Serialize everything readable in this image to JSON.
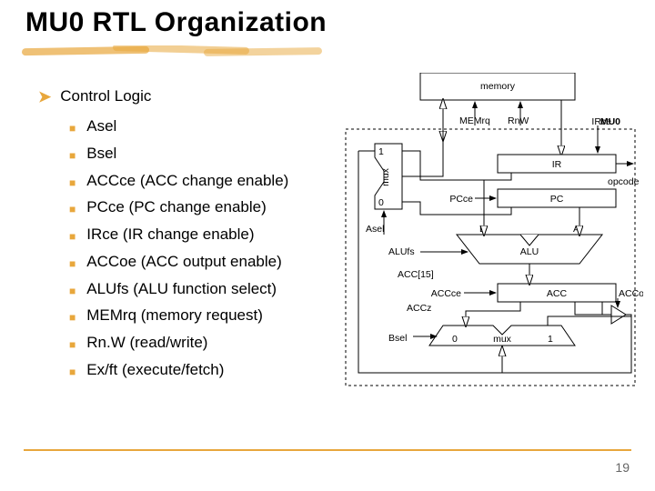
{
  "title": "MU0 RTL Organization",
  "heading": "Control Logic",
  "items": [
    "Asel",
    "Bsel",
    "ACCce (ACC change enable)",
    "PCce (PC change enable)",
    "IRce (IR change enable)",
    "ACCoe (ACC output enable)",
    "ALUfs (ALU function select)",
    "MEMrq (memory request)",
    "Rn.W (read/write)",
    "Ex/ft (execute/fetch)"
  ],
  "diagram": {
    "mu0": "MU0",
    "memory": "memory",
    "memrq": "MEMrq",
    "rnw": "RnW",
    "irce": "IRce",
    "ir": "IR",
    "opcode": "opcode",
    "pc": "PC",
    "pcce": "PCce",
    "asel": "Asel",
    "mux_top": "mux",
    "mux_1": "1",
    "mux_0": "0",
    "alufs": "ALUfs",
    "alu": "ALU",
    "b": "B",
    "a": "A",
    "accce": "ACCce",
    "acc": "ACC",
    "acc15": "ACC[15]",
    "accz": "ACCz",
    "accoe": "ACCoe",
    "bsel": "Bsel",
    "mux_bot": "mux",
    "mux_b0": "0",
    "mux_b1": "1"
  },
  "page": "19"
}
